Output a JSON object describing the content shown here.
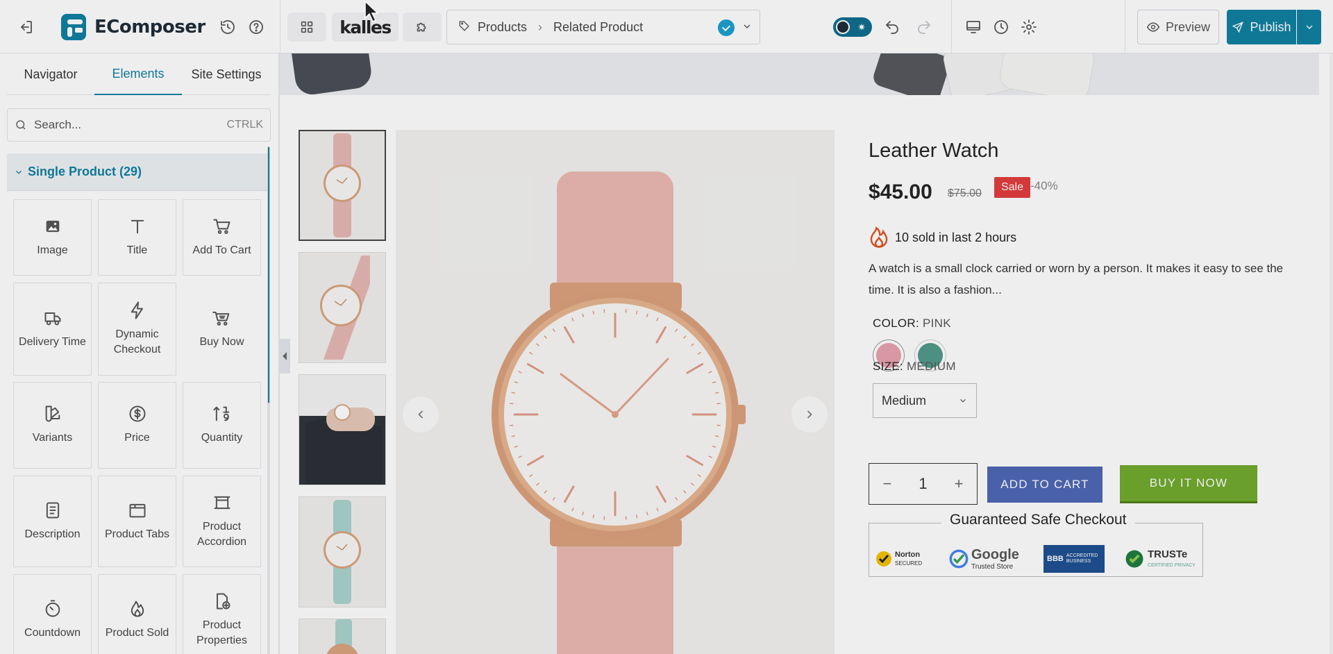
{
  "app": {
    "logo_text": "EComposer",
    "theme_name": "kalles",
    "breadcrumb": [
      "Products",
      "Related Product"
    ],
    "preview_label": "Preview",
    "publish_label": "Publish",
    "brand_color": "#0e7fa0"
  },
  "panel": {
    "tabs": [
      {
        "label": "Navigator",
        "active": false
      },
      {
        "label": "Elements",
        "active": true
      },
      {
        "label": "Site Settings",
        "active": false
      }
    ],
    "search": {
      "placeholder": "Search...",
      "shortcut": "CTRLK"
    },
    "section": {
      "title": "Single Product (29)"
    },
    "elements": [
      {
        "label": "Image",
        "icon": "image-icon"
      },
      {
        "label": "Title",
        "icon": "title-icon"
      },
      {
        "label": "Add To Cart",
        "icon": "cart-icon"
      },
      {
        "label": "Delivery Time",
        "icon": "truck-icon"
      },
      {
        "label": "Dynamic Checkout",
        "icon": "lightning-icon"
      },
      {
        "label": "Buy Now",
        "icon": "fast-cart-icon",
        "highlighted": true
      },
      {
        "label": "Variants",
        "icon": "swatch-icon"
      },
      {
        "label": "Price",
        "icon": "dollar-icon"
      },
      {
        "label": "Quantity",
        "icon": "sort-numeric-icon"
      },
      {
        "label": "Description",
        "icon": "document-icon"
      },
      {
        "label": "Product Tabs",
        "icon": "tabs-icon"
      },
      {
        "label": "Product Accordion",
        "icon": "accordion-icon"
      },
      {
        "label": "Countdown",
        "icon": "timer-icon"
      },
      {
        "label": "Product Sold",
        "icon": "flame-icon"
      },
      {
        "label": "Product Properties",
        "icon": "document-plus-icon"
      }
    ]
  },
  "product": {
    "title": "Leather Watch",
    "price": "$45.00",
    "compare_price": "$75.00",
    "sale_badge": "Sale",
    "discount": "-40%",
    "sold_text": "10 sold in last 2 hours",
    "description": "A watch is a small clock carried or worn by a person. It makes it easy to see the time. It is also a fashion...",
    "color_label": "COLOR:",
    "color_value": "PINK",
    "swatches": [
      "#e6a1ad",
      "#4f9a88"
    ],
    "size_label": "SIZE:",
    "size_value": "MEDIUM",
    "size_selected": "Medium",
    "quantity": "1",
    "add_to_cart": "ADD TO CART",
    "buy_now": "BUY IT NOW",
    "secure_title": "Guaranteed Safe Checkout",
    "badges": [
      {
        "name": "Norton",
        "sub": "SECURED"
      },
      {
        "name": "Google",
        "sub": "Trusted Store"
      },
      {
        "name": "BBB",
        "sub": "ACCREDITED BUSINESS"
      },
      {
        "name": "TRUSTe",
        "sub": "CERTIFIED PRIVACY"
      }
    ]
  }
}
